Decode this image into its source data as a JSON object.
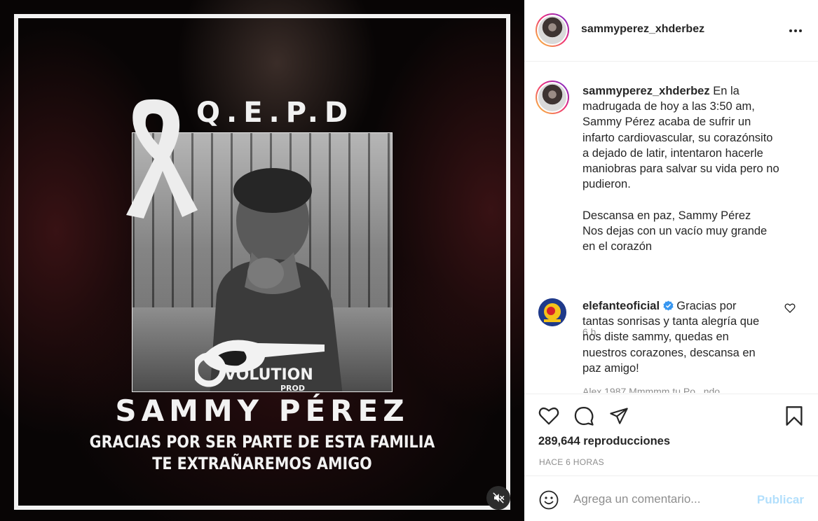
{
  "media": {
    "title_text": "Q.E.P.D",
    "name_text": "SAMMY PÉREZ",
    "line1": "GRACIAS POR SER PARTE DE ESTA FAMILIA",
    "line2": "TE EXTRAÑAREMOS AMIGO",
    "logo_main": "VOLUTION",
    "logo_sub": "PROD",
    "muted": true
  },
  "post": {
    "username": "sammyperez_xhderbez",
    "caption_user": "sammyperez_xhderbez",
    "caption_lines": [
      "En la",
      "madrugada de hoy a las 3:50 am,",
      "Sammy Pérez acaba de sufrir un",
      "infarto cardiovascular, su corazónsito",
      "a dejado de latir, intentaron hacerle",
      "maniobras para salvar su vida pero no",
      "pudieron.",
      "",
      "Descansa en paz, Sammy Pérez",
      "Nos dejas con un vacío muy grande",
      "en el corazón"
    ],
    "caption_time": "6 h",
    "comments": [
      {
        "user": "elefanteoficial",
        "verified": true,
        "text_lines": [
          "Gracias por",
          "tantas sonrisas y tanta alegría que",
          "nos diste sammy, quedas en",
          "nuestros corazones, descansa en",
          "paz amigo!"
        ]
      }
    ],
    "peek_text": "Alex 1987 Mmmmm tu Po...ndo",
    "views": "289,644 reproducciones",
    "time_ago": "HACE 6 HORAS",
    "comment_placeholder": "Agrega un comentario...",
    "post_button": "Publicar"
  },
  "icons": {
    "more": "more-horizontal-icon",
    "like": "heart-icon",
    "comment": "comment-bubble-icon",
    "share": "paper-plane-icon",
    "save": "bookmark-icon",
    "emoji": "emoji-smile-icon",
    "mute": "speaker-muted-icon",
    "verified": "verified-badge-icon"
  },
  "colors": {
    "text": "#262626",
    "secondary": "#8e8e8e",
    "border": "#efefef",
    "post_button_disabled": "#b2dffc",
    "verified": "#3897f0"
  }
}
